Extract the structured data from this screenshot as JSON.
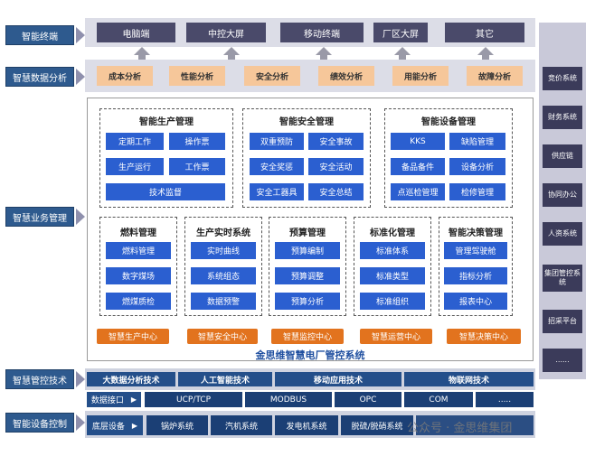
{
  "side_labels": [
    "智能终端",
    "智慧数据分析",
    "智慧业务管理",
    "智慧管控技术",
    "智能设备控制"
  ],
  "terminals": [
    "电脑端",
    "中控大屏",
    "移动终端",
    "厂区大屏",
    "其它"
  ],
  "analysis": [
    "成本分析",
    "性能分析",
    "安全分析",
    "绩效分析",
    "用能分析",
    "故障分析"
  ],
  "groups": {
    "production": {
      "title": "智能生产管理",
      "items": [
        "定期工作",
        "操作票",
        "生产运行",
        "工作票",
        "技术监督"
      ]
    },
    "safety": {
      "title": "智能安全管理",
      "items": [
        "双重预防",
        "安全事故",
        "安全奖惩",
        "安全活动",
        "安全工器具",
        "安全总结"
      ]
    },
    "equipment": {
      "title": "智能设备管理",
      "items": [
        "KKS",
        "缺陷管理",
        "备品备件",
        "设备分析",
        "点巡检管理",
        "检修管理"
      ]
    },
    "fuel": {
      "title": "燃料管理",
      "items": [
        "燃料管理",
        "数字煤场",
        "燃煤质检"
      ]
    },
    "realtime": {
      "title": "生产实时系统",
      "items": [
        "实时曲线",
        "系统组态",
        "数据预警"
      ]
    },
    "budget": {
      "title": "预算管理",
      "items": [
        "预算编制",
        "预算调整",
        "预算分析"
      ]
    },
    "standard": {
      "title": "标准化管理",
      "items": [
        "标准体系",
        "标准类型",
        "标准组织"
      ]
    },
    "decision": {
      "title": "智能决策管理",
      "items": [
        "管理驾驶舱",
        "指标分析",
        "报表中心"
      ]
    }
  },
  "centers": [
    "智慧生产中心",
    "智慧安全中心",
    "智慧监控中心",
    "智慧运营中心",
    "智慧决策中心"
  ],
  "system_title": "金思维智慧电厂管控系统",
  "right_items": [
    "竞价系统",
    "财务系统",
    "供应链",
    "协同办公",
    "人资系统",
    "集团管控系统",
    "招采平台",
    "......"
  ],
  "tech": [
    "大数据分析技术",
    "人工智能技术",
    "移动应用技术",
    "物联网技术"
  ],
  "protocols": {
    "label": "数据接口",
    "items": [
      "UCP/TCP",
      "MODBUS",
      "OPC",
      "COM",
      "....."
    ]
  },
  "devices": {
    "label": "底层设备",
    "items": [
      "锅炉系统",
      "汽机系统",
      "发电机系统",
      "脱硫/脱硝系统"
    ]
  },
  "watermark": "公众号 · 金思维集团"
}
